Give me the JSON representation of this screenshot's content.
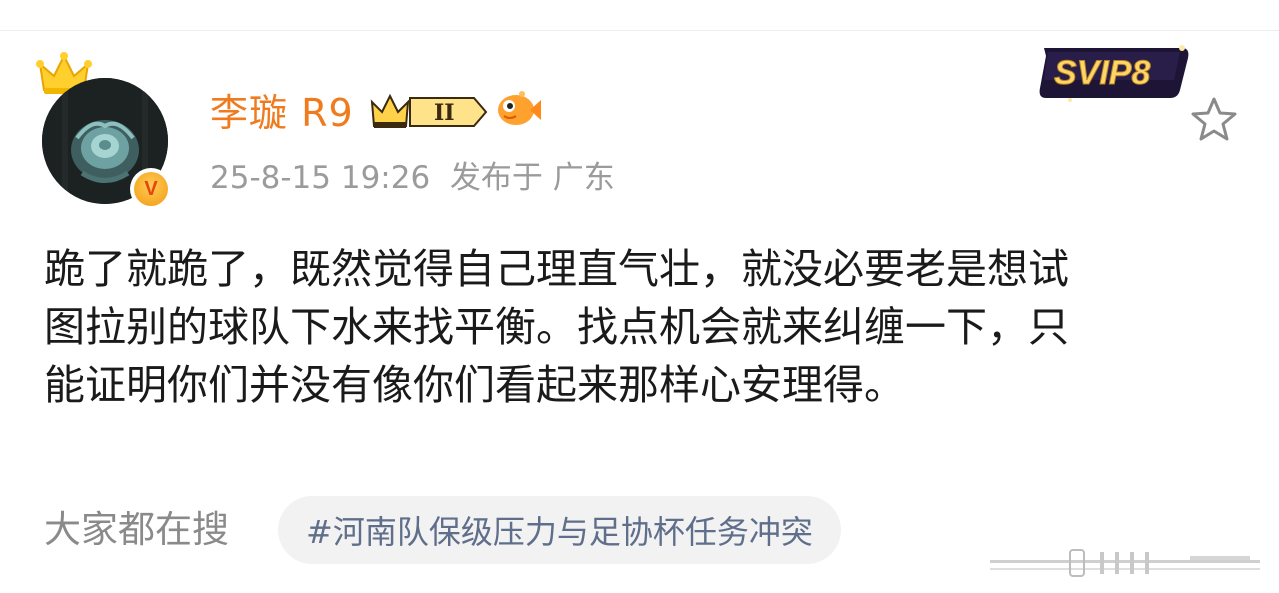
{
  "post": {
    "author": "李璇 R9",
    "timestamp": "25-8-15 19:26",
    "location": "发布于 广东",
    "vip_level": "II",
    "svip_label": "SVIP8",
    "content_lines": [
      "跪了就跪了，既然觉得自己理直气壮，就没必要老是想试",
      "图拉别的球队下水来找平衡。找点机会就来纠缠一下，只",
      "能证明你们并没有像你们看起来那样心安理得。"
    ]
  },
  "search": {
    "label": "大家都在搜",
    "topic": "#河南队保级压力与足协杯任务冲突"
  },
  "colors": {
    "username": "#f07b1e",
    "meta": "#9b9b9b",
    "topic": "#5f6e8a",
    "chip_bg": "#f2f2f2"
  },
  "icons": [
    "crown-icon",
    "verified-icon",
    "vip-crown-icon",
    "fish-icon",
    "svip-badge",
    "star-icon"
  ]
}
